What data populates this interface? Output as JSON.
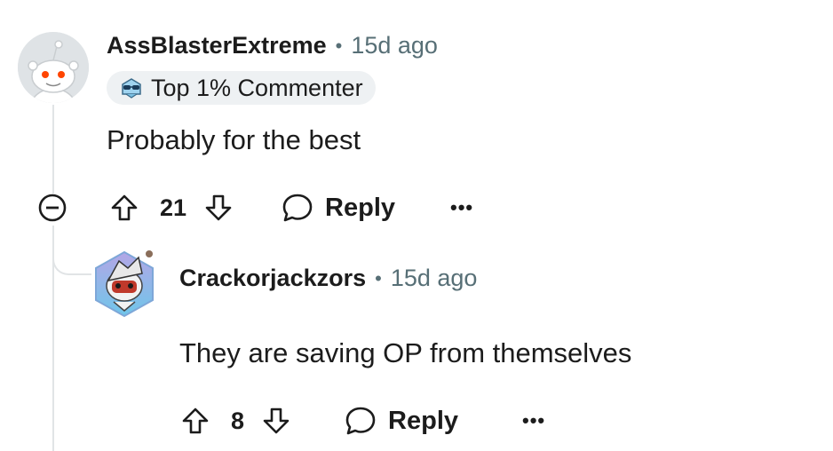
{
  "comment1": {
    "username": "AssBlasterExtreme",
    "separator": "•",
    "time": "15d ago",
    "badge": {
      "label": "Top 1% Commenter",
      "icon": "sunglasses-badge-icon"
    },
    "body": "Probably for the best",
    "votes": "21",
    "reply_label": "Reply",
    "more_label": "•••"
  },
  "comment2": {
    "username": "Crackorjackzors",
    "separator": "•",
    "time": "15d ago",
    "body": "They are saving OP from themselves",
    "votes": "8",
    "reply_label": "Reply",
    "more_label": "•••"
  },
  "colors": {
    "text": "#1c1c1c",
    "meta": "#576f76",
    "thread_line": "#e1e4e6",
    "badge_bg": "#eef1f3"
  }
}
